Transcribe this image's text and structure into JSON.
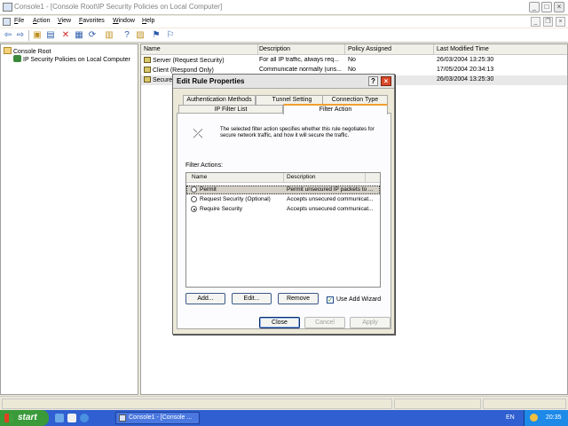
{
  "window": {
    "title": "Console1 - [Console Root\\IP Security Policies on Local Computer]"
  },
  "menu": {
    "items": [
      {
        "label": "File",
        "underline": "F",
        "rest": "ile"
      },
      {
        "label": "Action",
        "underline": "A",
        "rest": "ction"
      },
      {
        "label": "View",
        "underline": "V",
        "rest": "iew"
      },
      {
        "label": "Favorites",
        "underline": "F",
        "rest": "avorites"
      },
      {
        "label": "Window",
        "underline": "W",
        "rest": "indow"
      },
      {
        "label": "Help",
        "underline": "H",
        "rest": "elp"
      }
    ]
  },
  "tree": {
    "root": "Console Root",
    "child": "IP Security Policies on Local Computer"
  },
  "list": {
    "columns": [
      "Name",
      "Description",
      "Policy Assigned",
      "Last Modified Time"
    ],
    "rows": [
      {
        "name": "Server (Request Security)",
        "description": "For all IP traffic, always req...",
        "assigned": "No",
        "modified": "26/03/2004 13:25:30"
      },
      {
        "name": "Client (Respond Only)",
        "description": "Communicate normally (uns...",
        "assigned": "No",
        "modified": "17/05/2004 20:34:13"
      },
      {
        "name": "Secure S",
        "description": "",
        "assigned": "",
        "modified": "26/03/2004 13:25:30"
      }
    ]
  },
  "dialog": {
    "title": "Edit Rule Properties",
    "tabs_back": [
      "Authentication Methods",
      "Tunnel Setting",
      "Connection Type"
    ],
    "tabs_front": [
      "IP Filter List",
      "Filter Action"
    ],
    "description": "The selected filter action specifies whether this rule negotiates for secure network traffic, and how it will secure the traffic.",
    "filter_actions_label": "Filter Actions:",
    "filter_columns": [
      "Name",
      "Description"
    ],
    "filter_rows": [
      {
        "name": "Permit",
        "description": "Permit unsecured IP packets to ..."
      },
      {
        "name": "Request Security (Optional)",
        "description": "Accepts unsecured communicat..."
      },
      {
        "name": "Require Security",
        "description": "Accepts unsecured communicat..."
      }
    ],
    "buttons": {
      "add": "Add...",
      "edit": "Edit...",
      "remove": "Remove",
      "use_add_wizard": "Use Add Wizard",
      "close": "Close",
      "cancel": "Cancel",
      "apply": "Apply"
    }
  },
  "taskbar": {
    "start": "start",
    "task": "Console1 - [Console ...",
    "lang": "EN",
    "clock": "20:35"
  }
}
